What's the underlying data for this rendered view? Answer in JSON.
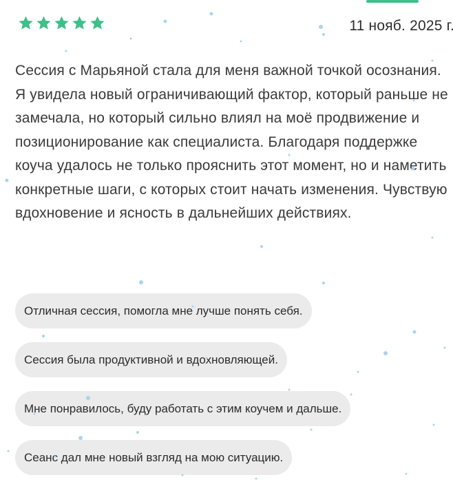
{
  "rating": {
    "stars_filled": 5,
    "stars_total": 5,
    "star_color": "#3fbf8a"
  },
  "review": {
    "date": "11 нояб. 2025 г.",
    "text": "Сессия с Марьяной стала для меня важной точкой осознания. Я увидела новый ограничивающий фактор, который раньше не замечала, но который сильно влиял на моё продвижение и позиционирование как специалиста. Благодаря поддержке коуча удалось не только прояснить этот момент, но и наметить конкретные шаги, с которых стоит начать изменения. Чувствую вдохновение и ясность в дальнейших действиях."
  },
  "tags": [
    {
      "label": "Отличная сессия, помогла мне лучше понять себя."
    },
    {
      "label": "Сессия была продуктивной и вдохновляющей."
    },
    {
      "label": "Мне понравилось, буду работать с этим коучем и дальше."
    },
    {
      "label": "Сеанс дал мне новый взгляд на мою ситуацию."
    }
  ],
  "colors": {
    "accent": "#3fbf8a",
    "chip_background": "#ebebeb",
    "text": "#3a3a3a",
    "snow": "#a9d4ef"
  }
}
